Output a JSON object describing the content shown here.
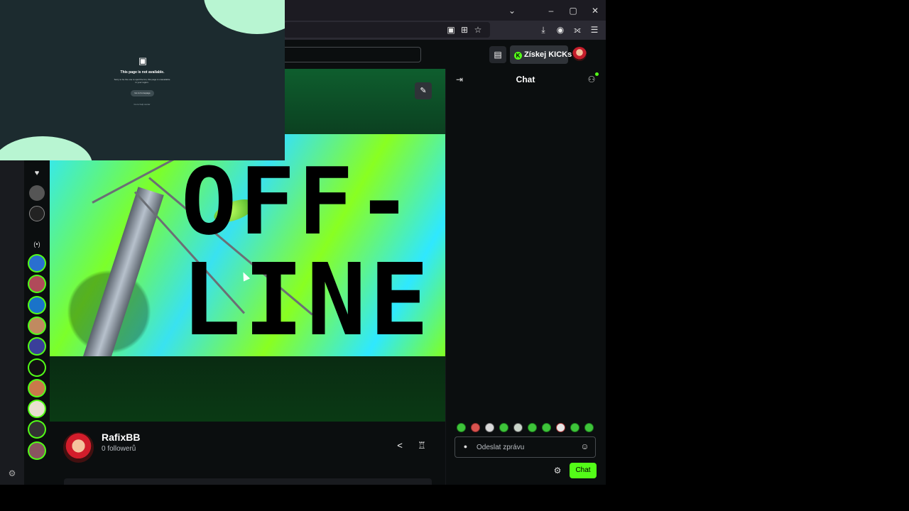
{
  "browser": {
    "window_controls": {
      "dropdown": "⌄",
      "minimize": "–",
      "maximize": "▢",
      "close": "✕"
    },
    "nav_icons": [
      "▣",
      "⊞",
      "☆",
      "⤓",
      "◉",
      "⟗",
      "☰"
    ]
  },
  "header": {
    "kicks_label": "Získej KICKs",
    "kicks_icon": "K",
    "layout_icon": "▤"
  },
  "stream": {
    "offline_line1": "OFF-",
    "offline_line2": "LINE",
    "edit_icon": "✎"
  },
  "channel": {
    "name": "RafixBB",
    "followers": "0 followerů",
    "share_icon": "<",
    "gift_icon": "♖"
  },
  "sidebar": {
    "heart_icon": "♥",
    "live_icon": "(•)",
    "settings_icon": "⚙"
  },
  "chat": {
    "title": "Chat",
    "collapse_icon": "⇥",
    "users_icon": "⚇",
    "input_placeholder": "Odeslat zprávu",
    "input_icon": "●",
    "emoji_icon": "☺",
    "settings_icon": "⚙",
    "send_label": "Chat"
  },
  "pip": {
    "icon": "▣",
    "title": "This page is not available.",
    "description": "Sorry to be the one to spoil the fun, this page is unavailable in your region.",
    "button": "Go to homepage",
    "link": "Go to help center"
  },
  "colors": {
    "accent": "#53fc18",
    "background": "#0b0e0f",
    "pip_bg": "#1c2b2f",
    "pip_blob": "#b8f5d2"
  }
}
